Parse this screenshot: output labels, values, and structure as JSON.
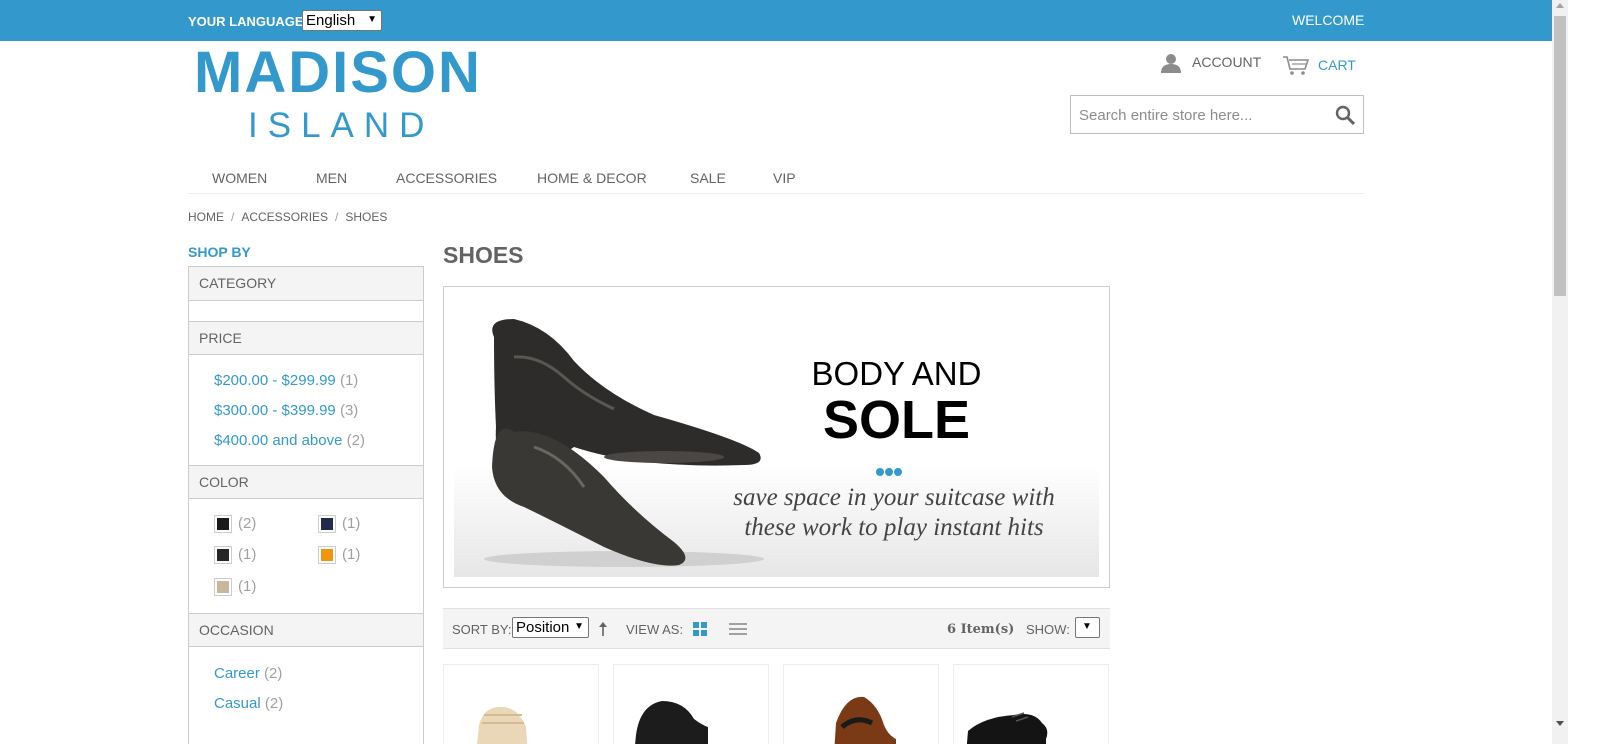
{
  "header": {
    "language_label": "YOUR LANGUAGE:",
    "language_value": "English",
    "welcome": "WELCOME",
    "logo_line1": "MADISON",
    "logo_line2": "ISLAND",
    "account_label": "ACCOUNT",
    "cart_label": "CART",
    "search_placeholder": "Search entire store here..."
  },
  "nav": {
    "items": [
      "WOMEN",
      "MEN",
      "ACCESSORIES",
      "HOME & DECOR",
      "SALE",
      "VIP"
    ]
  },
  "breadcrumb": {
    "items": [
      "HOME",
      "ACCESSORIES",
      "SHOES"
    ],
    "separator": "/"
  },
  "sidebar": {
    "title": "SHOP BY",
    "category_head": "CATEGORY",
    "price_head": "PRICE",
    "price_options": [
      {
        "label": "$200.00 - $299.99",
        "count": "(1)"
      },
      {
        "label": "$300.00 - $399.99",
        "count": "(3)"
      },
      {
        "label": "$400.00 and above",
        "count": "(2)"
      }
    ],
    "color_head": "COLOR",
    "color_options": [
      {
        "color": "#1a1a1a",
        "count": "(2)"
      },
      {
        "color": "#222a4d",
        "count": "(1)"
      },
      {
        "color": "#262626",
        "count": "(1)"
      },
      {
        "color": "#f3940d",
        "count": "(1)"
      },
      {
        "color": "#c8b79a",
        "count": "(1)"
      }
    ],
    "occasion_head": "OCCASION",
    "occasion_options": [
      {
        "label": "Career",
        "count": "(2)"
      },
      {
        "label": "Casual",
        "count": "(2)"
      }
    ]
  },
  "main": {
    "title": "SHOES",
    "banner": {
      "line1": "BODY AND",
      "line2": "SOLE",
      "tagline1": "save space in your suitcase with",
      "tagline2": "these work to play instant hits"
    },
    "toolbar": {
      "sort_label": "SORT BY:",
      "sort_value": "Position",
      "view_label": "VIEW AS:",
      "items_count": "6 Item(s)",
      "show_label": "SHOW:"
    }
  },
  "colors": {
    "accent": "#3399cc",
    "text": "#636363",
    "muted": "#a0a0a0"
  }
}
